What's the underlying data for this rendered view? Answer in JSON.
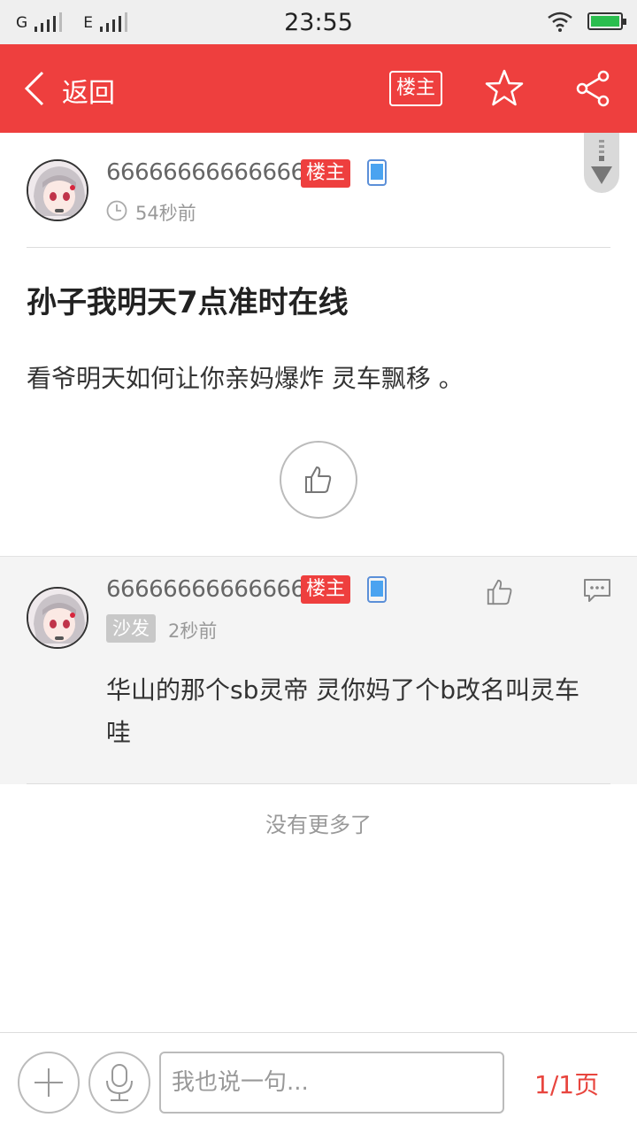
{
  "status_bar": {
    "network_1": "G",
    "network_2": "E",
    "time": "23:55"
  },
  "header": {
    "back_label": "返回",
    "owner_button": "楼主",
    "icons": [
      "back-icon",
      "star-icon",
      "share-icon"
    ],
    "color": "#ee3f3e"
  },
  "post": {
    "username": "666666666666666",
    "badge": "楼主",
    "time": "54秒前",
    "title": "孙子我明天7点准时在线",
    "body": "看爷明天如何让你亲妈爆炸 灵车飘移 。"
  },
  "reply": {
    "username": "666666666666666",
    "badge": "楼主",
    "floor": "沙发",
    "time": "2秒前",
    "text": "华山的那个sb灵帝 灵你妈了个b改名叫灵车哇"
  },
  "no_more": "没有更多了",
  "bottom_bar": {
    "input_placeholder": "我也说一句...",
    "page": "1/1页",
    "accent": "#e8453e"
  }
}
